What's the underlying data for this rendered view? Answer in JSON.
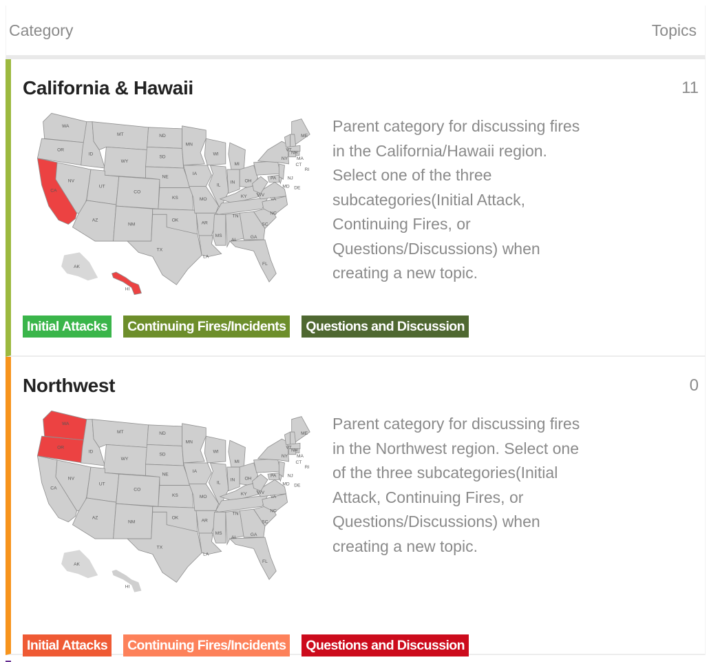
{
  "header": {
    "category_label": "Category",
    "topics_label": "Topics"
  },
  "categories": [
    {
      "name": "California & Hawaii",
      "topics": "11",
      "accent_color": "#9cb93f",
      "highlighted_states": [
        "CA",
        "HI"
      ],
      "description": "Parent category for discussing fires in the California/Hawaii region. Select one of the three subcategories(Initial Attack, Continuing Fires, or Questions/Discussions) when creating a new topic.",
      "subcategories": [
        {
          "label": "Initial Attacks",
          "color": "#3ab54a"
        },
        {
          "label": "Continuing Fires/Incidents",
          "color": "#6d8e2b"
        },
        {
          "label": "Questions and Discussion",
          "color": "#4f6831"
        }
      ]
    },
    {
      "name": "Northwest",
      "topics": "0",
      "accent_color": "#f7941d",
      "highlighted_states": [
        "WA",
        "OR"
      ],
      "description": "Parent category for discussing fires in the Northwest region. Select one of the three subcategories(Initial Attack, Continuing Fires, or Questions/Discussions) when creating a new topic.",
      "subcategories": [
        {
          "label": "Initial Attacks",
          "color": "#ef5a34"
        },
        {
          "label": "Continuing Fires/Incidents",
          "color": "#fd815a"
        },
        {
          "label": "Questions and Discussion",
          "color": "#cc0b1c"
        }
      ]
    }
  ],
  "map_labels": [
    "WA",
    "OR",
    "CA",
    "ID",
    "NV",
    "MT",
    "WY",
    "UT",
    "AZ",
    "CO",
    "NM",
    "ND",
    "SD",
    "NE",
    "KS",
    "OK",
    "TX",
    "MN",
    "IA",
    "MO",
    "AR",
    "LA",
    "WI",
    "IL",
    "MI",
    "IN",
    "OH",
    "KY",
    "TN",
    "MS",
    "AL",
    "GA",
    "FL",
    "SC",
    "NC",
    "VA",
    "WV",
    "PA",
    "NY",
    "ME",
    "VT",
    "NH",
    "MA",
    "CT",
    "RI",
    "NJ",
    "DE",
    "MD",
    "AK",
    "HI"
  ]
}
